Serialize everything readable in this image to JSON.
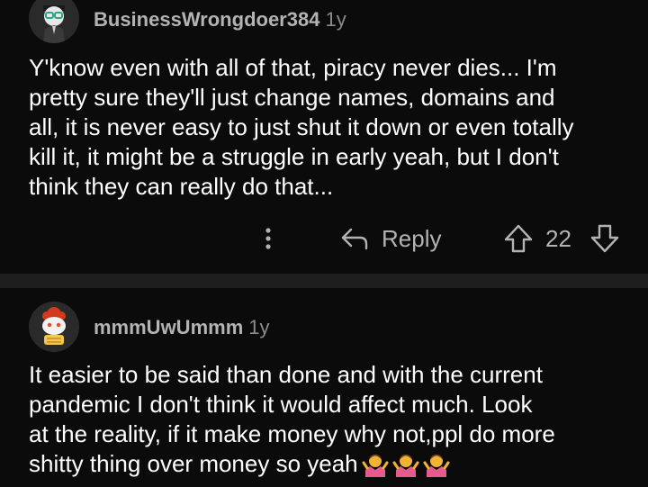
{
  "comments": [
    {
      "username": "BusinessWrongdoer384",
      "age": "1y",
      "lines": [
        "Y'know even with all of that, piracy never dies... I'm",
        "pretty sure they'll just change names, domains and",
        "all, it is never easy to just shut it down or even totally",
        "kill it, it might be a struggle in early yeah, but I don't",
        "think they can really do that..."
      ],
      "actions": {
        "reply_label": "Reply",
        "score": "22"
      }
    },
    {
      "username": "mmmUwUmmm",
      "age": "1y",
      "lines": [
        "It easier to be said than done and with the current",
        "pandemic I don't think it would affect much. Look",
        "at the reality, if it make money why not,ppl do more",
        "shitty thing over money so yeah"
      ],
      "emoji": [
        "person-shrugging-emoji",
        "person-shrugging-emoji",
        "person-shrugging-emoji"
      ]
    }
  ],
  "colors": {
    "background": "#0b0b0b",
    "text": "#ffffff",
    "muted": "#b3b3b3",
    "divider": "#1e1e1e"
  }
}
